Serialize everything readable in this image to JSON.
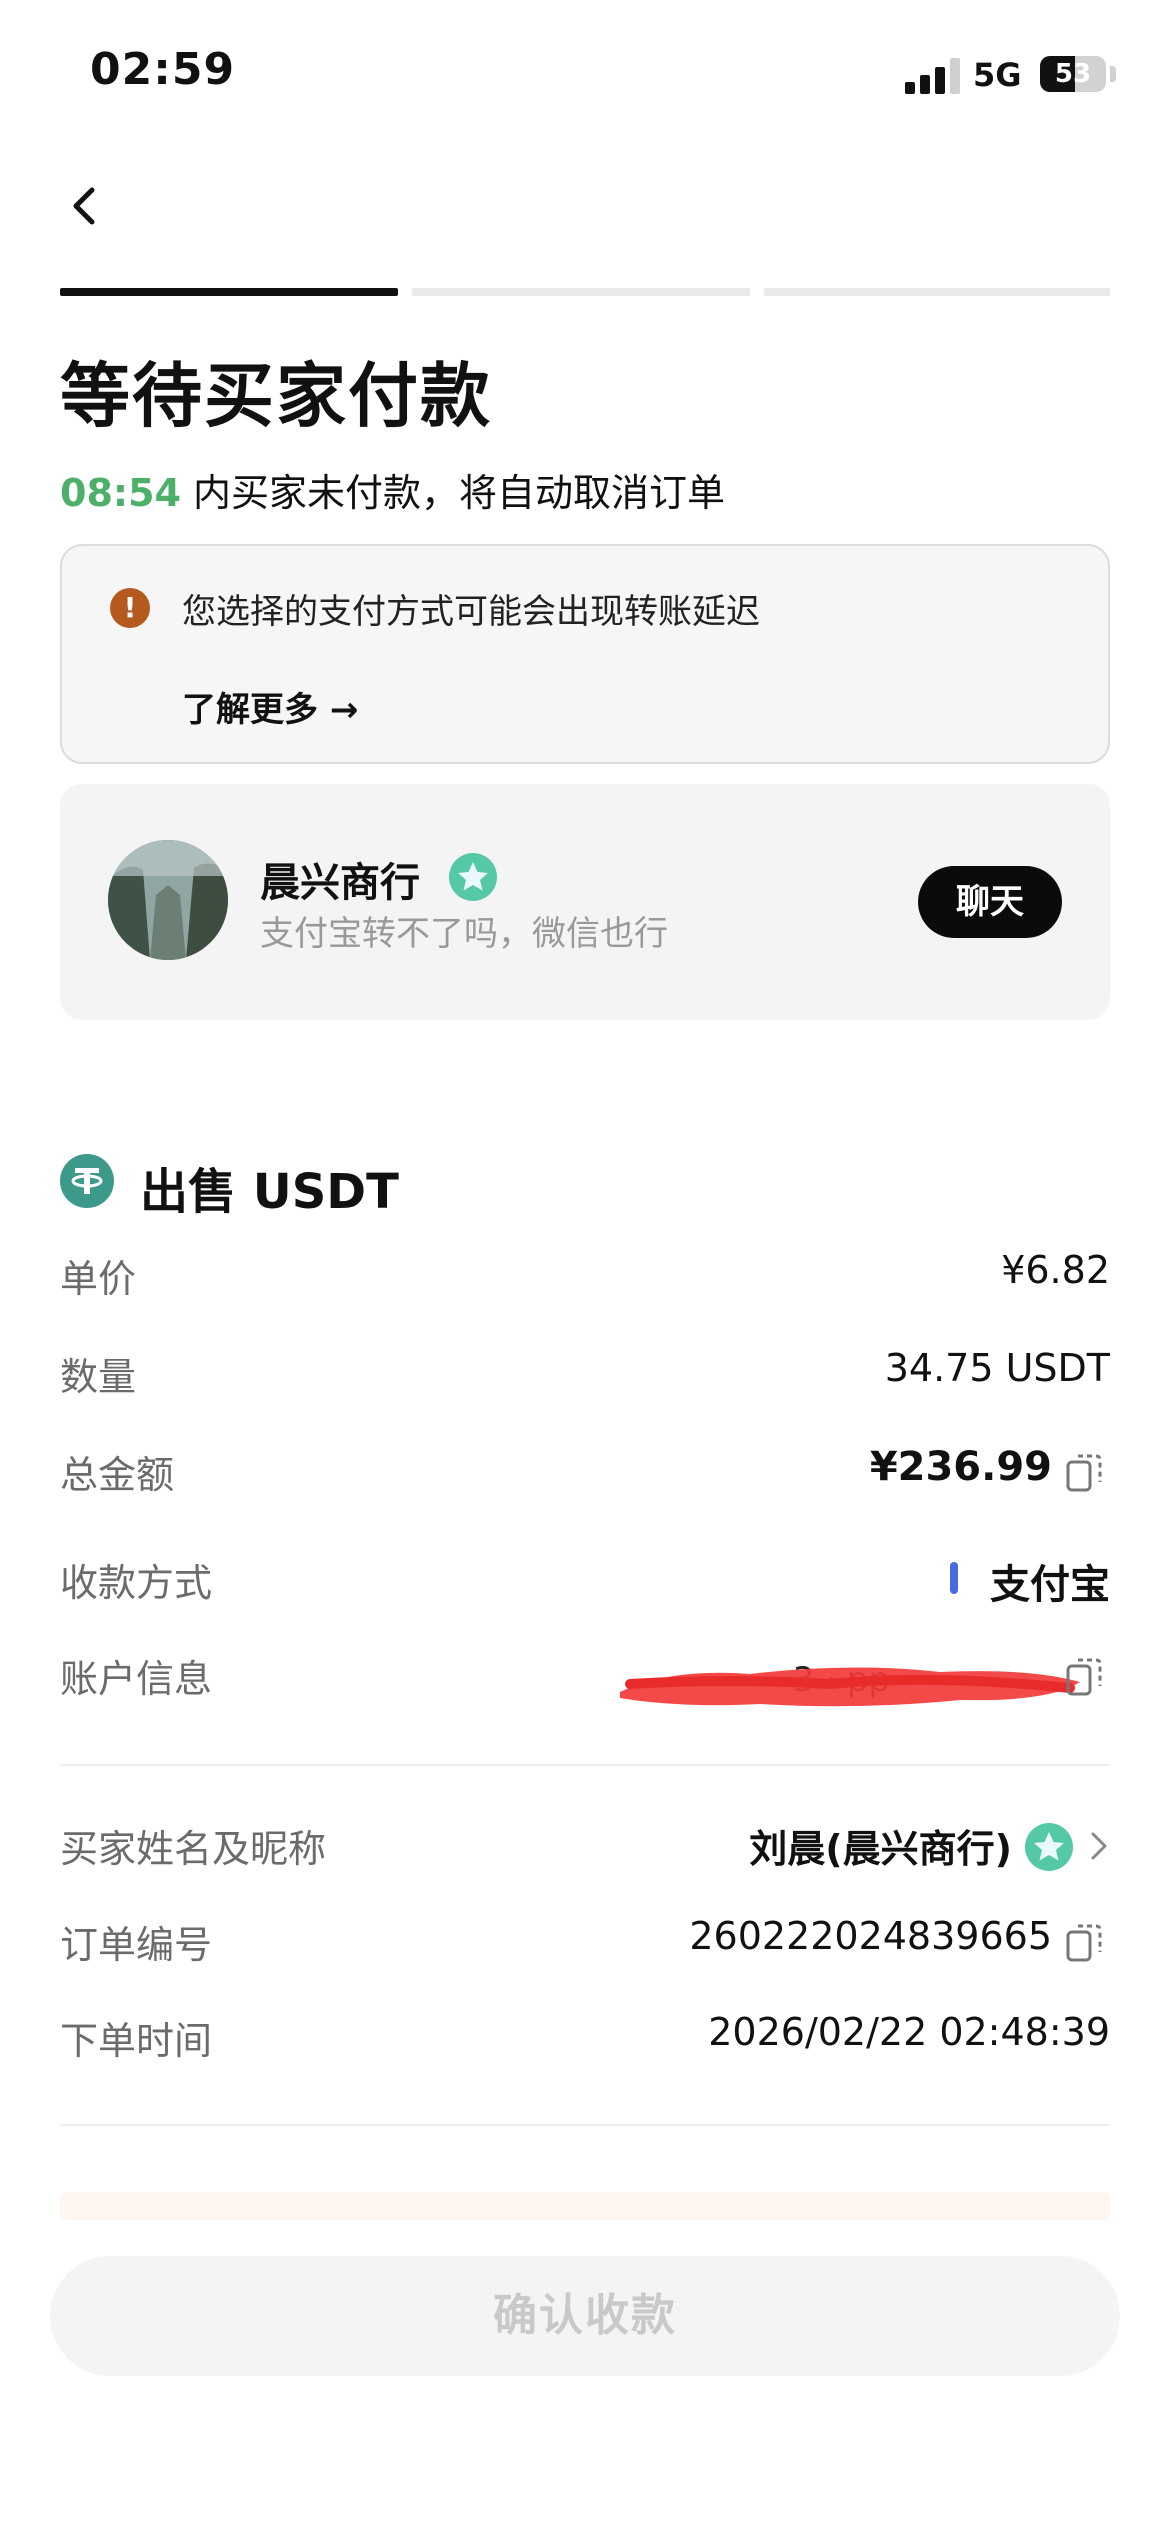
{
  "status_bar": {
    "time": "02:59",
    "network": "5G",
    "battery": "53",
    "battery_level": 0.53
  },
  "header": {
    "back_icon": "chevron-left-icon",
    "steps_total": 3,
    "steps_completed": 1
  },
  "page": {
    "title": "等待买家付款",
    "countdown": "08:54",
    "countdown_suffix": " 内买家未付款，将自动取消订单",
    "countdown_color": "#4cb06a"
  },
  "notice": {
    "icon": "exclamation-icon",
    "text": "您选择的支付方式可能会出现转账延迟",
    "link": "了解更多 →"
  },
  "merchant": {
    "name": "晨兴商行",
    "note": "支付宝转不了吗，微信也行",
    "chat_label": "聊天",
    "badge": "verified-star-icon"
  },
  "order": {
    "title": "出售 USDT",
    "icon": "tether-icon",
    "unit_price_label": "单价",
    "unit_price": "¥6.82",
    "quantity_label": "数量",
    "quantity": "34.75 USDT",
    "total_label": "总金额",
    "total": "¥236.99",
    "payment_method_label": "收款方式",
    "payment_method": "支付宝",
    "payment_color": "#4a6ae0",
    "account_label": "账户信息",
    "account_partial": "3 · pp",
    "buyer_label": "买家姓名及昵称",
    "buyer": "刘晨(晨兴商行)",
    "order_no_label": "订单编号",
    "order_no": "260222024839665",
    "order_time_label": "下单时间",
    "order_time": "2026/02/22 02:48:39"
  },
  "footer": {
    "confirm_label": "确认收款"
  }
}
